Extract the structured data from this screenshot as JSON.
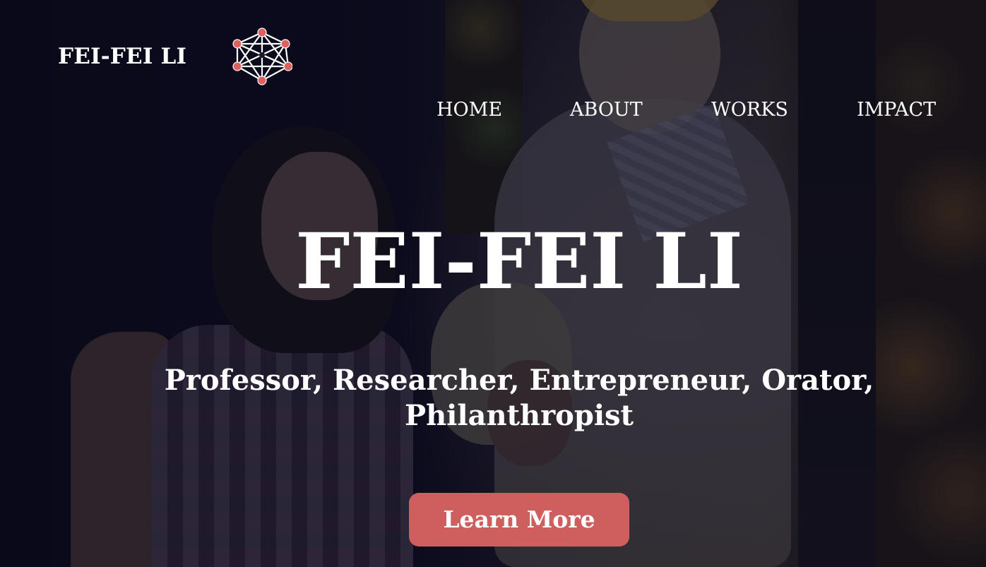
{
  "header": {
    "brand": "FEI-FEI LI",
    "logo_icon": "neural-network-icon"
  },
  "nav": {
    "items": [
      {
        "label": "HOME"
      },
      {
        "label": "ABOUT"
      },
      {
        "label": "WORKS"
      },
      {
        "label": "IMPACT"
      }
    ]
  },
  "hero": {
    "title": "FEI-FEI LI",
    "subtitle": "Professor, Researcher, Entrepreneur, Orator, Philanthropist",
    "cta_label": "Learn More"
  },
  "colors": {
    "accent": "#cf5f5e",
    "text": "#ffffff",
    "overlay": "#0d0c1c"
  }
}
